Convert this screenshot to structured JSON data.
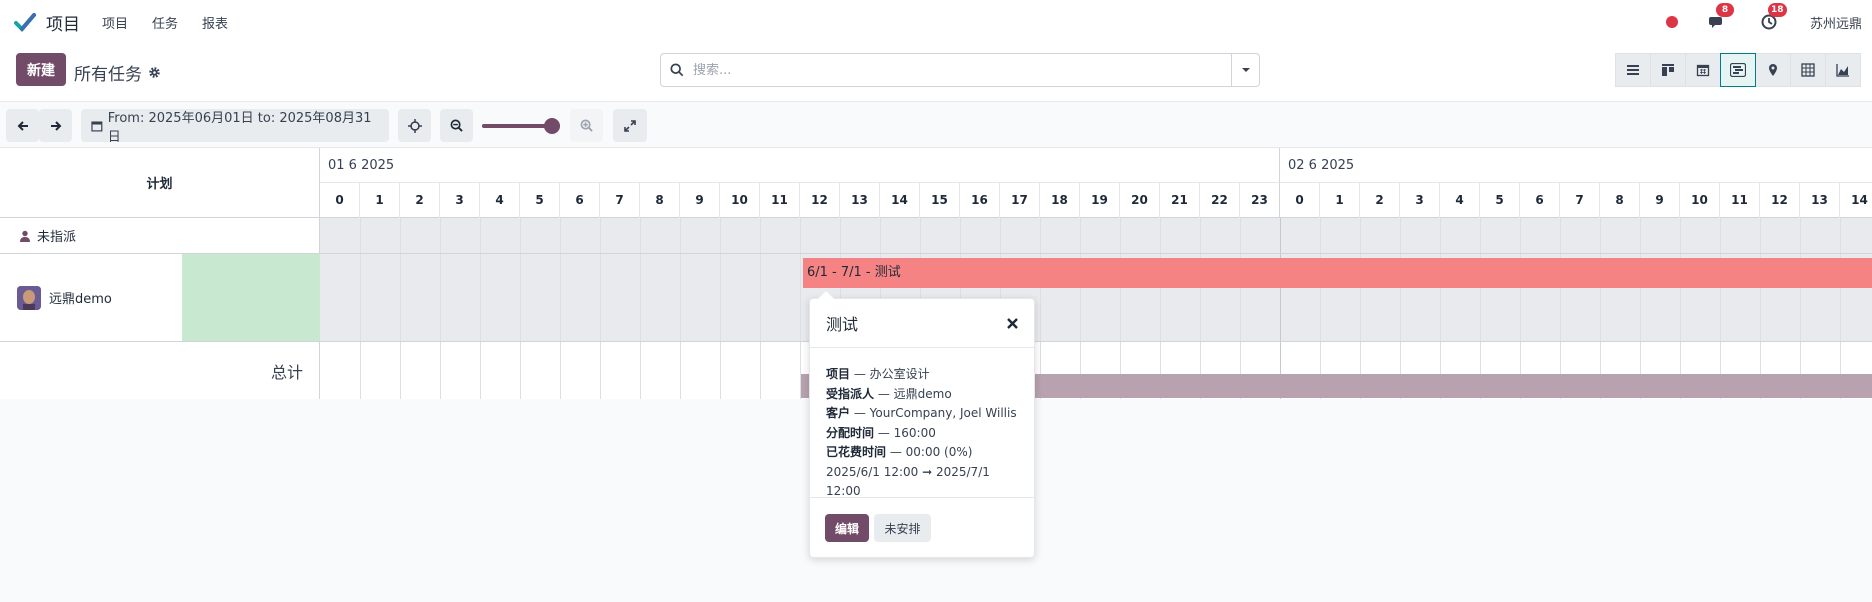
{
  "navbar": {
    "app_name": "项目",
    "menu": [
      "项目",
      "任务",
      "报表"
    ],
    "messages_count": "8",
    "activities_count": "18",
    "company": "苏州远鼎"
  },
  "control": {
    "new_label": "新建",
    "title": "所有任务",
    "search_placeholder": "搜索..."
  },
  "toolbar": {
    "date_range": "From: 2025年06月01日 to: 2025年08月31日",
    "zoom_level": 1.0
  },
  "gantt": {
    "header_label": "计划",
    "day1": "01 6 2025",
    "day2": "02 6 2025",
    "hours": [
      "0",
      "1",
      "2",
      "3",
      "4",
      "5",
      "6",
      "7",
      "8",
      "9",
      "10",
      "11",
      "12",
      "13",
      "14",
      "15",
      "16",
      "17",
      "18",
      "19",
      "20",
      "21",
      "22",
      "23",
      "0",
      "1",
      "2",
      "3",
      "4",
      "5",
      "6",
      "7",
      "8",
      "9",
      "10",
      "11",
      "12",
      "13",
      "14"
    ],
    "rows": {
      "unassigned": "未指派",
      "user": "远鼎demo",
      "total": "总计"
    },
    "task_bar_label": "6/1 - 7/1 - 测试"
  },
  "popover": {
    "title": "测试",
    "lines": [
      {
        "k": "项目",
        "v": " — 办公室设计"
      },
      {
        "k": "受指派人",
        "v": " — 远鼎demo"
      },
      {
        "k": "客户",
        "v": " — YourCompany, Joel Willis"
      },
      {
        "k": "分配时间",
        "v": " — 160:00"
      },
      {
        "k": "已花费时间",
        "v": " — 00:00 (0%)"
      }
    ],
    "dates": "2025/6/1 12:00 ➞ 2025/7/1 12:00",
    "edit_label": "编辑",
    "unschedule_label": "未安排"
  },
  "colors": {
    "brand": "#714b67",
    "task_bar": "#f58383",
    "total_bar": "#b8a2b0",
    "availability": "#c8e9d0",
    "badge": "#dc3545"
  }
}
